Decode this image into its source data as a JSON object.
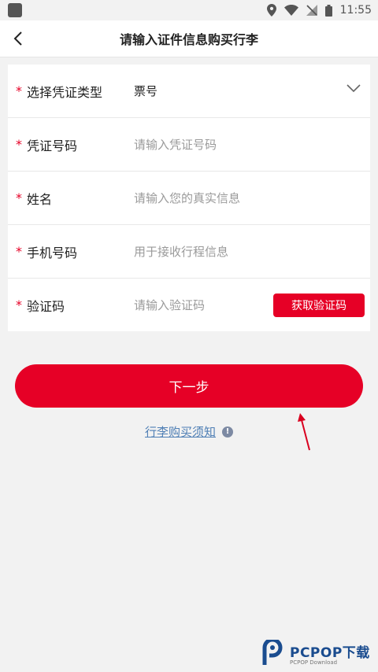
{
  "status_bar": {
    "time": "11:55"
  },
  "header": {
    "title": "请输入证件信息购买行李"
  },
  "form": {
    "required_mark": "*",
    "doc_type": {
      "label": "选择凭证类型",
      "value": "票号"
    },
    "doc_number": {
      "label": "凭证号码",
      "placeholder": "请输入凭证号码"
    },
    "name": {
      "label": "姓名",
      "placeholder": "请输入您的真实信息"
    },
    "phone": {
      "label": "手机号码",
      "placeholder": "用于接收行程信息"
    },
    "code": {
      "label": "验证码",
      "placeholder": "请输入验证码",
      "button": "获取验证码"
    }
  },
  "next_button": "下一步",
  "notice_link": "行李购买须知",
  "watermark": {
    "title": "PCPOP下载",
    "sub": "PCPOP Download"
  },
  "colors": {
    "accent": "#e60026",
    "link": "#4f7fb5"
  }
}
